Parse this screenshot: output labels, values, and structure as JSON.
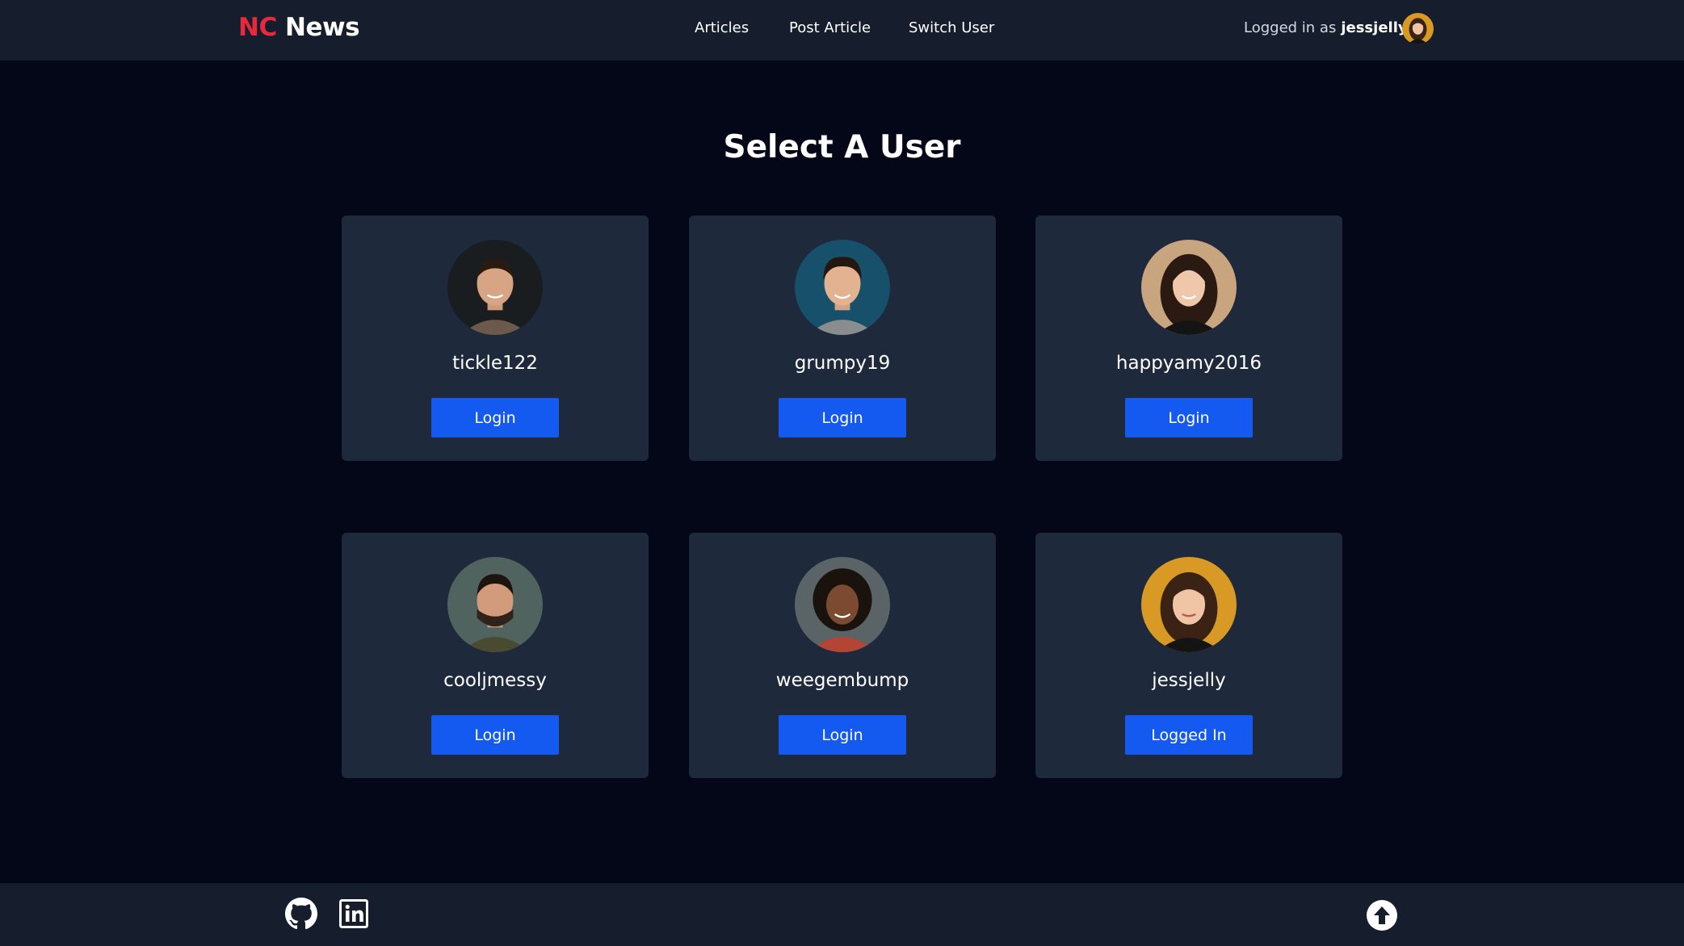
{
  "header": {
    "logo_prefix": "NC",
    "logo_suffix": "News",
    "nav": [
      "Articles",
      "Post Article",
      "Switch User"
    ],
    "logged_in_label": "Logged in as",
    "logged_in_user": "jessjelly"
  },
  "page": {
    "title": "Select A User"
  },
  "users": [
    {
      "username": "tickle122",
      "button": "Login"
    },
    {
      "username": "grumpy19",
      "button": "Login"
    },
    {
      "username": "happyamy2016",
      "button": "Login"
    },
    {
      "username": "cooljmessy",
      "button": "Login"
    },
    {
      "username": "weegembump",
      "button": "Login"
    },
    {
      "username": "jessjelly",
      "button": "Logged In"
    }
  ],
  "footer": {
    "icons": [
      "github-icon",
      "linkedin-icon",
      "scroll-to-top-icon"
    ]
  },
  "colors": {
    "background": "#030718",
    "bar": "#161e2d",
    "card": "#1e293c",
    "accent": "#1459f0",
    "logo_red": "#e8293d"
  }
}
